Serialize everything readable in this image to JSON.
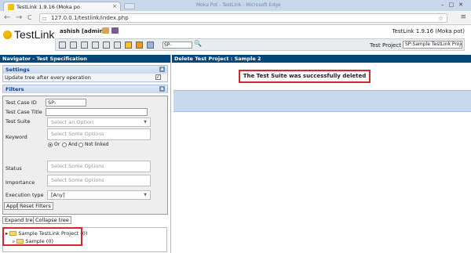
{
  "browser": {
    "tab_title": "TestLink 1.9.16 (Moka po",
    "tab_close": "×",
    "window_title": "Moka Pot - TestLink - Microsoft Edge",
    "window_controls": "–□✕",
    "back": "←",
    "forward": "→",
    "reload": "C",
    "url": "127.0.0.1/testlink/index.php",
    "star": "☆",
    "menu": "≡"
  },
  "header": {
    "logo": "TestLink",
    "user": "ashish [admin]",
    "version": "TestLink 1.9.16 (Moka pot)",
    "tc_search_value": "SP-",
    "test_project_label": "Test Project",
    "test_project_value": "SP:Sample TestLink Project ▼"
  },
  "left": {
    "title": "Navigator - Test Specification",
    "settings": {
      "title": "Settings",
      "update_tree_label": "Update tree after every operation",
      "update_tree_checked": "✓"
    },
    "filters": {
      "title": "Filters",
      "test_case_id_label": "Test Case ID",
      "test_case_id_value": "SP-",
      "test_case_title_label": "Test Case Title",
      "test_case_title_value": "",
      "test_suite_label": "Test Suite",
      "test_suite_placeholder": "Select an Option",
      "keyword_label": "Keyword",
      "keyword_placeholder": "Select Some Options",
      "keyword_or": "Or",
      "keyword_and": "And",
      "keyword_not_linked": "Not linked",
      "status_label": "Status",
      "status_placeholder": "Select Some Options",
      "importance_label": "Importance",
      "importance_placeholder": "Select Some Options",
      "execution_type_label": "Execution type",
      "execution_type_value": "[Any]"
    },
    "apply_button": "Apply",
    "reset_button": "Reset Filters",
    "expand_button": "Expand tree",
    "collapse_button": "Collapse tree",
    "tree": {
      "root": "Sample TestLink Project (0)",
      "child": "Sample (0)"
    }
  },
  "right": {
    "title": "Delete Test Project : Sample 2",
    "message": "The Test Suite was successfully deleted"
  }
}
